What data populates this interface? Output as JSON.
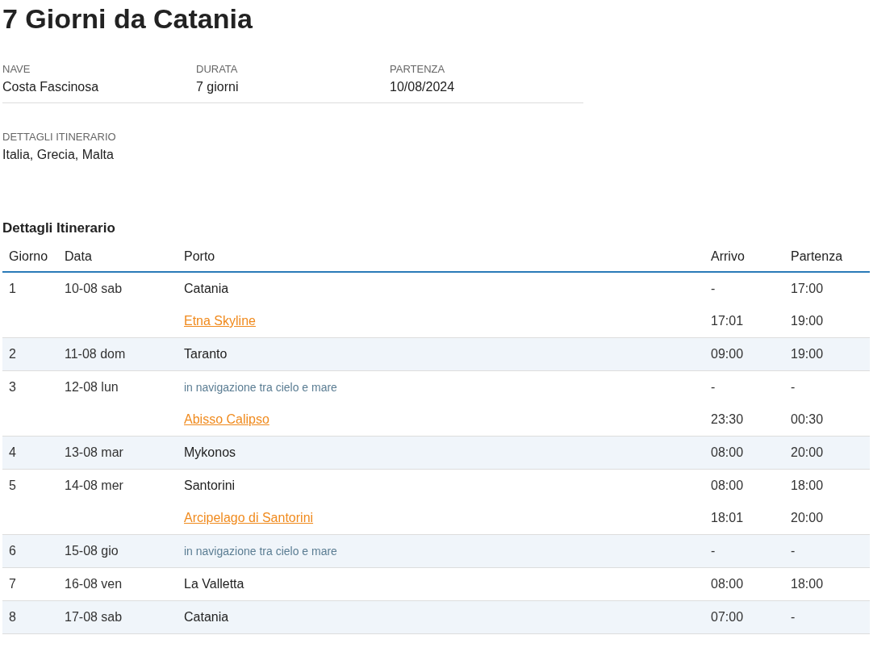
{
  "title": "7 Giorni da Catania",
  "info": [
    {
      "label": "NAVE",
      "value": "Costa Fascinosa"
    },
    {
      "label": "DURATA",
      "value": "7 giorni"
    },
    {
      "label": "PARTENZA",
      "value": "10/08/2024"
    }
  ],
  "itinerary_info": {
    "label": "DETTAGLI ITINERARIO",
    "value": "Italia, Grecia, Malta"
  },
  "section_title": "Dettagli Itinerario",
  "table": {
    "columns": [
      "Giorno",
      "Data",
      "Porto",
      "Arrivo",
      "Partenza"
    ],
    "days": [
      {
        "day": "1",
        "date": "10-08 sab",
        "stops": [
          {
            "kind": "port",
            "port": "Catania",
            "arrival": "-",
            "departure": "17:00"
          },
          {
            "kind": "excursion",
            "port": "Etna Skyline",
            "arrival": "17:01",
            "departure": "19:00"
          }
        ]
      },
      {
        "day": "2",
        "date": "11-08 dom",
        "stops": [
          {
            "kind": "port",
            "port": "Taranto",
            "arrival": "09:00",
            "departure": "19:00"
          }
        ]
      },
      {
        "day": "3",
        "date": "12-08 lun",
        "stops": [
          {
            "kind": "sea",
            "port": "in navigazione tra cielo e mare",
            "arrival": "-",
            "departure": "-"
          },
          {
            "kind": "excursion",
            "port": "Abisso Calipso",
            "arrival": "23:30",
            "departure": "00:30"
          }
        ]
      },
      {
        "day": "4",
        "date": "13-08 mar",
        "stops": [
          {
            "kind": "port",
            "port": "Mykonos",
            "arrival": "08:00",
            "departure": "20:00"
          }
        ]
      },
      {
        "day": "5",
        "date": "14-08 mer",
        "stops": [
          {
            "kind": "port",
            "port": "Santorini",
            "arrival": "08:00",
            "departure": "18:00"
          },
          {
            "kind": "excursion",
            "port": "Arcipelago di Santorini",
            "arrival": "18:01",
            "departure": "20:00"
          }
        ]
      },
      {
        "day": "6",
        "date": "15-08 gio",
        "stops": [
          {
            "kind": "sea",
            "port": "in navigazione tra cielo e mare",
            "arrival": "-",
            "departure": "-"
          }
        ]
      },
      {
        "day": "7",
        "date": "16-08 ven",
        "stops": [
          {
            "kind": "port",
            "port": "La Valletta",
            "arrival": "08:00",
            "departure": "18:00"
          }
        ]
      },
      {
        "day": "8",
        "date": "17-08 sab",
        "stops": [
          {
            "kind": "port",
            "port": "Catania",
            "arrival": "07:00",
            "departure": "-"
          }
        ]
      }
    ]
  }
}
